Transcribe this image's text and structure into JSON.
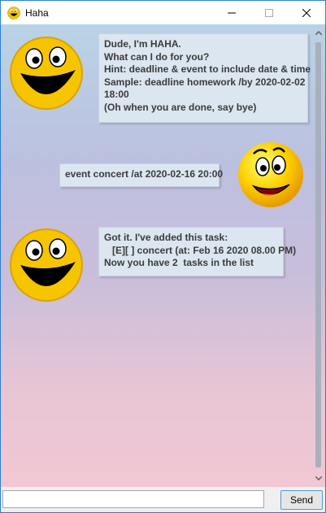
{
  "window": {
    "title": "Haha"
  },
  "messages": [
    {
      "sender": "bot",
      "text": "Dude, I'm HAHA.\nWhat can I do for you?\nHint: deadline & event to include date & time\nSample: deadline homework /by 2020-02-02\n18:00\n(Oh when you are done, say bye)"
    },
    {
      "sender": "user",
      "text": "event concert /at 2020-02-16 20:00"
    },
    {
      "sender": "bot",
      "text": "Got it. I've added this task:\n   [E][ ] concert (at: Feb 16 2020 08.00 PM)\nNow you have 2  tasks in the list"
    }
  ],
  "input": {
    "value": "",
    "placeholder": ""
  },
  "send_label": "Send",
  "icons": {
    "app": "laughing-face-icon",
    "bot_avatar": "laughing-face-icon",
    "user_avatar": "smiling-face-icon"
  },
  "colors": {
    "bubble": "#dbe6f0",
    "gradient_top": "#b9d3e6",
    "gradient_bottom": "#f1c7d3",
    "accent": "#4c9bd8"
  }
}
